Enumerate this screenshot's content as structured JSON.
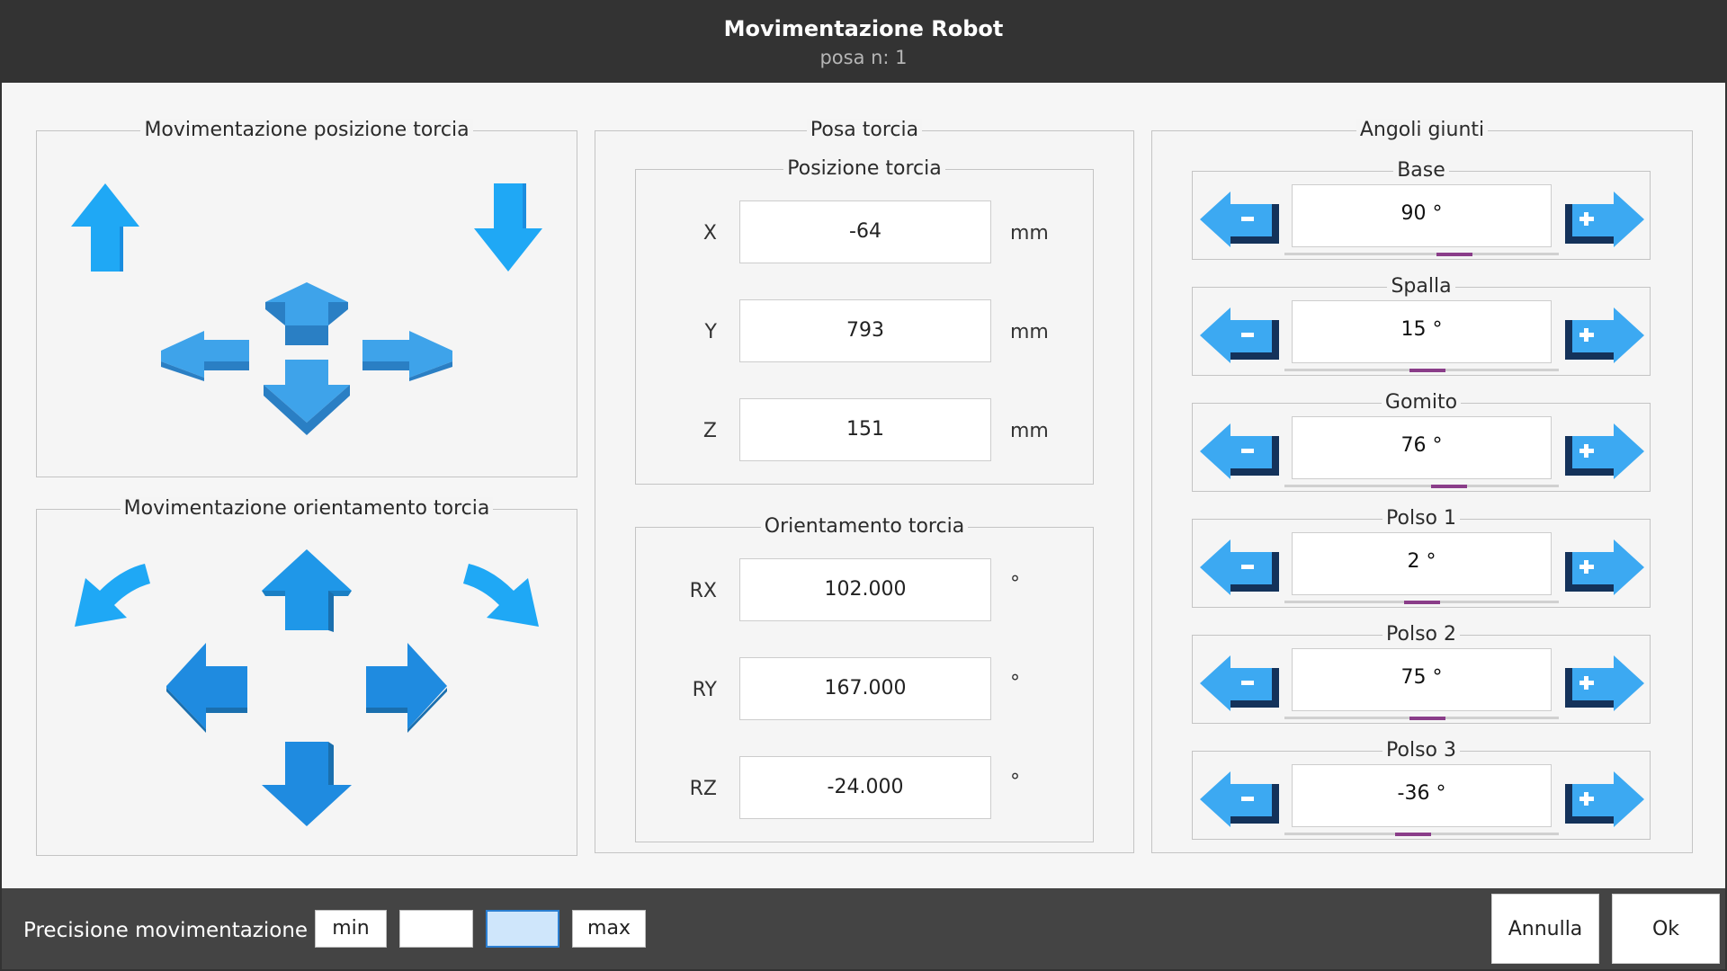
{
  "header": {
    "title": "Movimentazione Robot",
    "subtitle": "posa n: 1"
  },
  "position_panel": {
    "title": "Movimentazione posizione torcia"
  },
  "orientation_panel": {
    "title": "Movimentazione orientamento torcia"
  },
  "pose_panel": {
    "title": "Posa torcia",
    "position_group": {
      "title": "Posizione torcia",
      "rows": [
        {
          "label": "X",
          "value": "-64",
          "unit": "mm"
        },
        {
          "label": "Y",
          "value": "793",
          "unit": "mm"
        },
        {
          "label": "Z",
          "value": "151",
          "unit": "mm"
        }
      ]
    },
    "orientation_group": {
      "title": "Orientamento torcia",
      "rows": [
        {
          "label": "RX",
          "value": "102.000",
          "unit": "°"
        },
        {
          "label": "RY",
          "value": "167.000",
          "unit": "°"
        },
        {
          "label": "RZ",
          "value": "-24.000",
          "unit": "°"
        }
      ]
    }
  },
  "joints_panel": {
    "title": "Angoli giunti",
    "joints": [
      {
        "name": "Base",
        "value": "90  °",
        "slider_percent": 62
      },
      {
        "name": "Spalla",
        "value": "15  °",
        "slider_percent": 52
      },
      {
        "name": "Gomito",
        "value": "76  °",
        "slider_percent": 60
      },
      {
        "name": "Polso 1",
        "value": "2  °",
        "slider_percent": 50
      },
      {
        "name": "Polso 2",
        "value": "75  °",
        "slider_percent": 52
      },
      {
        "name": "Polso 3",
        "value": "-36  °",
        "slider_percent": 47
      }
    ]
  },
  "footer": {
    "precision_label": "Precisione movimentazione",
    "precision_options": [
      "min",
      "",
      "",
      "max"
    ],
    "selected_index": 2,
    "cancel_label": "Annulla",
    "ok_label": "Ok"
  },
  "colors": {
    "arrow_light": "#1fa8f5",
    "arrow_mid": "#2aa3f0",
    "arrow_dark": "#1a8ddf",
    "slider": "#8a3d89",
    "header_bg": "#333333",
    "footer_bg": "#444444",
    "selected_btn": "#cfe6fb"
  }
}
